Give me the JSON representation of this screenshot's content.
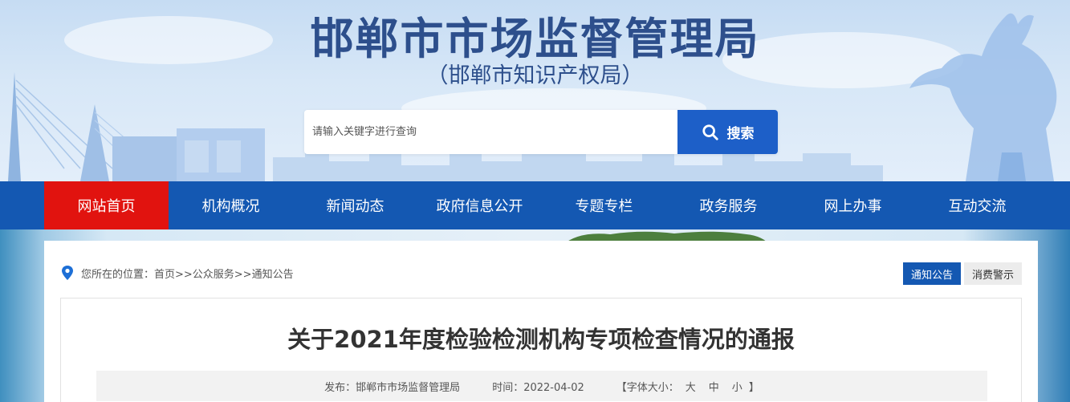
{
  "header": {
    "title": "邯郸市市场监督管理局",
    "subtitle": "（邯郸市知识产权局）"
  },
  "search": {
    "placeholder": "请输入关键字进行查询",
    "button_label": "搜索",
    "icon": "search-icon"
  },
  "nav": {
    "items": [
      {
        "label": "网站首页",
        "active": true
      },
      {
        "label": "机构概况"
      },
      {
        "label": "新闻动态"
      },
      {
        "label": "政府信息公开"
      },
      {
        "label": "专题专栏"
      },
      {
        "label": "政务服务"
      },
      {
        "label": "网上办事"
      },
      {
        "label": "互动交流"
      }
    ]
  },
  "breadcrumb": {
    "icon": "location-pin-icon",
    "text": "您所在的位置：首页>>公众服务>>通知公告"
  },
  "tabs": [
    {
      "label": "通知公告",
      "active": true
    },
    {
      "label": "消费警示"
    }
  ],
  "article": {
    "title": "关于2021年度检验检测机构专项检查情况的通报",
    "publisher": "发布：邯郸市市场监督管理局",
    "time": "时间：2022-04-02",
    "font_size_prefix": "【字体大小：",
    "font_large": "大",
    "font_medium": "中",
    "font_small": "小",
    "font_size_suffix": "】"
  },
  "colors": {
    "nav_bg": "#1458b2",
    "nav_active": "#e1130f",
    "search_button": "#1d5fc8",
    "title_color": "#2d4f8c"
  }
}
